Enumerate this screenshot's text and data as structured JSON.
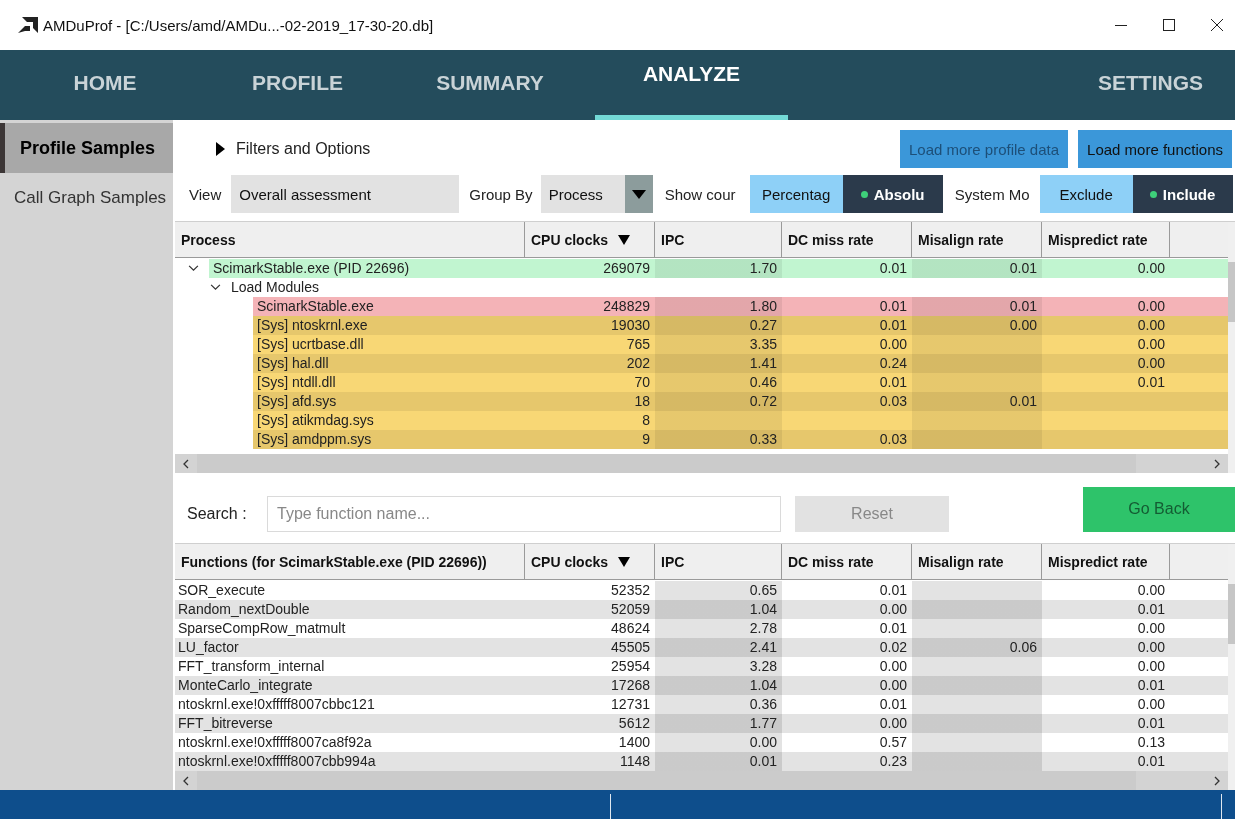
{
  "window": {
    "title": "AMDuProf - [C:/Users/amd/AMDu...-02-2019_17-30-20.db]"
  },
  "nav": [
    {
      "label": "HOME",
      "selected": false
    },
    {
      "label": "PROFILE",
      "selected": false
    },
    {
      "label": "SUMMARY",
      "selected": false
    },
    {
      "label": "ANALYZE",
      "selected": true
    },
    {
      "label": "SETTINGS",
      "selected": false
    }
  ],
  "sidebar": [
    {
      "label": "Profile Samples",
      "selected": true
    },
    {
      "label": "Call Graph Samples",
      "selected": false
    }
  ],
  "filters": {
    "label": "Filters and Options",
    "expanded": false
  },
  "load_buttons": [
    {
      "label": "Load more profile data",
      "disabled": true
    },
    {
      "label": "Load more functions",
      "disabled": false
    }
  ],
  "view": {
    "label": "View",
    "value": "Overall assessment"
  },
  "group_by": {
    "label": "Group By",
    "value": "Process"
  },
  "show_counts": {
    "label": "Show cour",
    "options": [
      {
        "label": "Percentag",
        "selected": false
      },
      {
        "label": "Absolu",
        "selected": true
      }
    ]
  },
  "system_modules": {
    "label": "System Mo",
    "options": [
      {
        "label": "Exclude",
        "selected": false
      },
      {
        "label": "Include",
        "selected": true
      }
    ]
  },
  "process_table": {
    "columns": [
      {
        "label": "Process",
        "sorted": false
      },
      {
        "label": "CPU clocks",
        "sorted": true
      },
      {
        "label": "IPC",
        "sorted": false
      },
      {
        "label": "DC miss rate",
        "sorted": false
      },
      {
        "label": "Misalign rate",
        "sorted": false
      },
      {
        "label": "Mispredict rate",
        "sorted": false
      }
    ],
    "rows": [
      {
        "name": "ScimarkStable.exe (PID 22696)",
        "expanded": true,
        "color": "#c1f5d0",
        "values": {
          "cpu_clocks": "269079",
          "ipc": "1.70",
          "dc_miss_rate": "0.01",
          "misalign_rate": "0.01",
          "mispredict_rate": "0.00"
        },
        "children": [
          {
            "name": "Load Modules",
            "expanded": true,
            "children": [
              {
                "name": "ScimarkStable.exe",
                "color": "#f4b3b7",
                "values": {
                  "cpu_clocks": "248829",
                  "ipc": "1.80",
                  "dc_miss_rate": "0.01",
                  "misalign_rate": "0.01",
                  "mispredict_rate": "0.00"
                }
              },
              {
                "name": "[Sys] ntoskrnl.exe",
                "color": "#e6c76c",
                "values": {
                  "cpu_clocks": "19030",
                  "ipc": "0.27",
                  "dc_miss_rate": "0.01",
                  "misalign_rate": "0.00",
                  "mispredict_rate": "0.00"
                }
              },
              {
                "name": "[Sys] ucrtbase.dll",
                "color": "#f8d775",
                "values": {
                  "cpu_clocks": "765",
                  "ipc": "3.35",
                  "dc_miss_rate": "0.00",
                  "mispredict_rate": "0.00"
                }
              },
              {
                "name": "[Sys] hal.dll",
                "color": "#e6c76c",
                "values": {
                  "cpu_clocks": "202",
                  "ipc": "1.41",
                  "dc_miss_rate": "0.24",
                  "mispredict_rate": "0.00"
                }
              },
              {
                "name": "[Sys] ntdll.dll",
                "color": "#f8d775",
                "values": {
                  "cpu_clocks": "70",
                  "ipc": "0.46",
                  "dc_miss_rate": "0.01",
                  "mispredict_rate": "0.01"
                }
              },
              {
                "name": "[Sys] afd.sys",
                "color": "#e6c76c",
                "values": {
                  "cpu_clocks": "18",
                  "ipc": "0.72",
                  "dc_miss_rate": "0.03",
                  "misalign_rate": "0.01"
                }
              },
              {
                "name": "[Sys] atikmdag.sys",
                "color": "#f8d775",
                "values": {
                  "cpu_clocks": "8"
                }
              },
              {
                "name": "[Sys] amdppm.sys",
                "color": "#e6c76c",
                "values": {
                  "cpu_clocks": "9",
                  "ipc": "0.33",
                  "dc_miss_rate": "0.03"
                }
              }
            ]
          }
        ]
      }
    ]
  },
  "search": {
    "label": "Search :",
    "placeholder": "Type function name..."
  },
  "reset_button": {
    "label": "Reset",
    "disabled": true
  },
  "go_back_button": {
    "label": "Go Back",
    "disabled": true
  },
  "functions_table": {
    "columns": [
      {
        "label": "Functions (for ScimarkStable.exe (PID 22696))",
        "sorted": false
      },
      {
        "label": "CPU clocks",
        "sorted": true
      },
      {
        "label": "IPC",
        "sorted": false
      },
      {
        "label": "DC miss rate",
        "sorted": false
      },
      {
        "label": "Misalign rate",
        "sorted": false
      },
      {
        "label": "Mispredict rate",
        "sorted": false
      }
    ],
    "rows": [
      {
        "name": "SOR_execute",
        "values": {
          "cpu_clocks": "52352",
          "ipc": "0.65",
          "dc_miss_rate": "0.01",
          "mispredict_rate": "0.00"
        }
      },
      {
        "name": "Random_nextDouble",
        "values": {
          "cpu_clocks": "52059",
          "ipc": "1.04",
          "dc_miss_rate": "0.00",
          "mispredict_rate": "0.01"
        }
      },
      {
        "name": "SparseCompRow_matmult",
        "values": {
          "cpu_clocks": "48624",
          "ipc": "2.78",
          "dc_miss_rate": "0.01",
          "mispredict_rate": "0.00"
        }
      },
      {
        "name": "LU_factor",
        "values": {
          "cpu_clocks": "45505",
          "ipc": "2.41",
          "dc_miss_rate": "0.02",
          "misalign_rate": "0.06",
          "mispredict_rate": "0.00"
        }
      },
      {
        "name": "FFT_transform_internal",
        "values": {
          "cpu_clocks": "25954",
          "ipc": "3.28",
          "dc_miss_rate": "0.00",
          "mispredict_rate": "0.00"
        }
      },
      {
        "name": "MonteCarlo_integrate",
        "values": {
          "cpu_clocks": "17268",
          "ipc": "1.04",
          "dc_miss_rate": "0.00",
          "mispredict_rate": "0.01"
        }
      },
      {
        "name": "ntoskrnl.exe!0xfffff8007cbbc121",
        "values": {
          "cpu_clocks": "12731",
          "ipc": "0.36",
          "dc_miss_rate": "0.01",
          "mispredict_rate": "0.00"
        }
      },
      {
        "name": "FFT_bitreverse",
        "values": {
          "cpu_clocks": "5612",
          "ipc": "1.77",
          "dc_miss_rate": "0.00",
          "mispredict_rate": "0.01"
        }
      },
      {
        "name": "ntoskrnl.exe!0xfffff8007ca8f92a",
        "values": {
          "cpu_clocks": "1400",
          "ipc": "0.00",
          "dc_miss_rate": "0.57",
          "mispredict_rate": "0.13"
        }
      },
      {
        "name": "ntoskrnl.exe!0xfffff8007cbb994a",
        "values": {
          "cpu_clocks": "1148",
          "ipc": "0.01",
          "dc_miss_rate": "0.23",
          "mispredict_rate": "0.01"
        }
      }
    ]
  }
}
